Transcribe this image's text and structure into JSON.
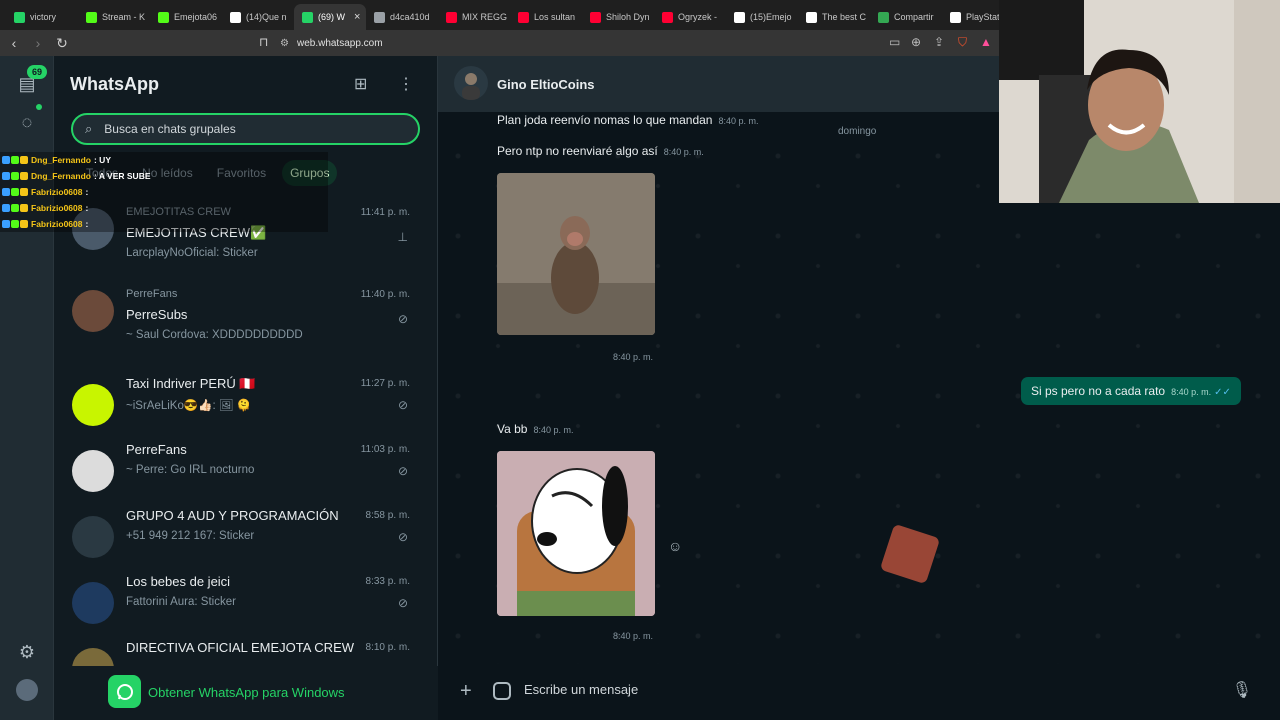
{
  "browser": {
    "tabs": [
      {
        "label": "victory",
        "color": "#25d366",
        "active": false
      },
      {
        "label": "Stream - K",
        "color": "#53fc18",
        "active": false
      },
      {
        "label": "Emejota06",
        "color": "#53fc18",
        "active": false
      },
      {
        "label": "(14)Que n",
        "color": "#ffffff",
        "active": false
      },
      {
        "label": "(69) W",
        "color": "#25d366",
        "active": true
      },
      {
        "label": "d4ca410d",
        "color": "#9aa0a6",
        "active": false
      },
      {
        "label": "MIX REGG",
        "color": "#ff0033",
        "active": false
      },
      {
        "label": "Los sultan",
        "color": "#ff0033",
        "active": false
      },
      {
        "label": "Shiloh Dyn",
        "color": "#ff0033",
        "active": false
      },
      {
        "label": "Ogryzek -",
        "color": "#ff0033",
        "active": false
      },
      {
        "label": "(15)Emejo",
        "color": "#ffffff",
        "active": false
      },
      {
        "label": "The best C",
        "color": "#ffffff",
        "active": false
      },
      {
        "label": "Compartir",
        "color": "#34a853",
        "active": false
      },
      {
        "label": "PlayStation",
        "color": "#ffffff",
        "active": false
      }
    ],
    "url": "web.whatsapp.com"
  },
  "rail": {
    "chats_badge": "69"
  },
  "list": {
    "title": "WhatsApp",
    "search_placeholder": "Busca en chats grupales",
    "filters": [
      "Todos",
      "No leídos",
      "Favoritos",
      "Grupos"
    ],
    "chats": [
      {
        "top": "EMEJOTITAS CREW",
        "name": "EMEJOTITAS CREW✅",
        "msg": "LarcplayNoOficial: Sticker",
        "time": "11:41 p. m.",
        "icon": "pin-icon",
        "avatar": "#4a5a6a"
      },
      {
        "top": "PerreFans",
        "name": "PerreSubs",
        "msg": "~ Saul Cordova: XDDDDDDDDDD",
        "time": "11:40 p. m.",
        "icon": "muted-icon",
        "avatar": "#6b4a3a"
      },
      {
        "top": "",
        "name": "Taxi Indriver PERÚ 🇵🇪",
        "msg": "~iSrAeLiKo😎👍🏻: 🖼 🫠",
        "time": "11:27 p. m.",
        "icon": "muted-icon",
        "avatar": "#c8f500"
      },
      {
        "top": "",
        "name": "PerreFans",
        "msg": "~ Perre: Go IRL nocturno",
        "time": "11:03 p. m.",
        "icon": "muted-icon",
        "avatar": "#dcdcdc"
      },
      {
        "top": "",
        "name": "GRUPO 4 AUD Y PROGRAMACIÓN",
        "msg": "+51 949 212 167: Sticker",
        "time": "8:58 p. m.",
        "icon": "muted-icon",
        "avatar": "#2a3942"
      },
      {
        "top": "",
        "name": "Los bebes de jeici",
        "msg": "Fattorini Aura: Sticker",
        "time": "8:33 p. m.",
        "icon": "muted-icon",
        "avatar": "#1e3a5f"
      },
      {
        "top": "",
        "name": "DIRECTIVA OFICIAL EMEJOTA CREW",
        "msg": "",
        "time": "8:10 p. m.",
        "icon": "",
        "avatar": "#7a6a3a"
      }
    ],
    "get_app": "Obtener WhatsApp para Windows"
  },
  "conversation": {
    "name": "Gino EltioCoins",
    "messages": [
      {
        "text": "Plan joda reenvío nomas lo que mandan",
        "time": "8:40 p. m."
      },
      {
        "text": "Pero ntp no reenviaré algo así",
        "time": "8:40 p. m."
      },
      {
        "text": "Va bb",
        "time": "8:40 p. m."
      }
    ],
    "media_times": [
      "8:40 p. m.",
      "8:40 p. m."
    ],
    "day_separator": "domingo",
    "outgoing": {
      "text": "Si ps pero no a cada rato",
      "time": "8:40 p. m."
    },
    "composer_placeholder": "Escribe un mensaje"
  },
  "stream_chat": [
    {
      "user": "Dng_Fernando",
      "text": ": UY",
      "color": "#f5c518"
    },
    {
      "user": "Dng_Fernando",
      "text": ": A VER SUBE",
      "color": "#f5c518"
    },
    {
      "user": "Fabrizio0608",
      "text": ":",
      "color": "#f5c518"
    },
    {
      "user": "Fabrizio0608",
      "text": ":",
      "color": "#f5c518"
    },
    {
      "user": "Fabrizio0608",
      "text": ":",
      "color": "#f5c518"
    }
  ],
  "colors": {
    "accent": "#25d366",
    "outgoing_bubble": "#005c4b",
    "panel": "#111b21",
    "header": "#202c33"
  }
}
